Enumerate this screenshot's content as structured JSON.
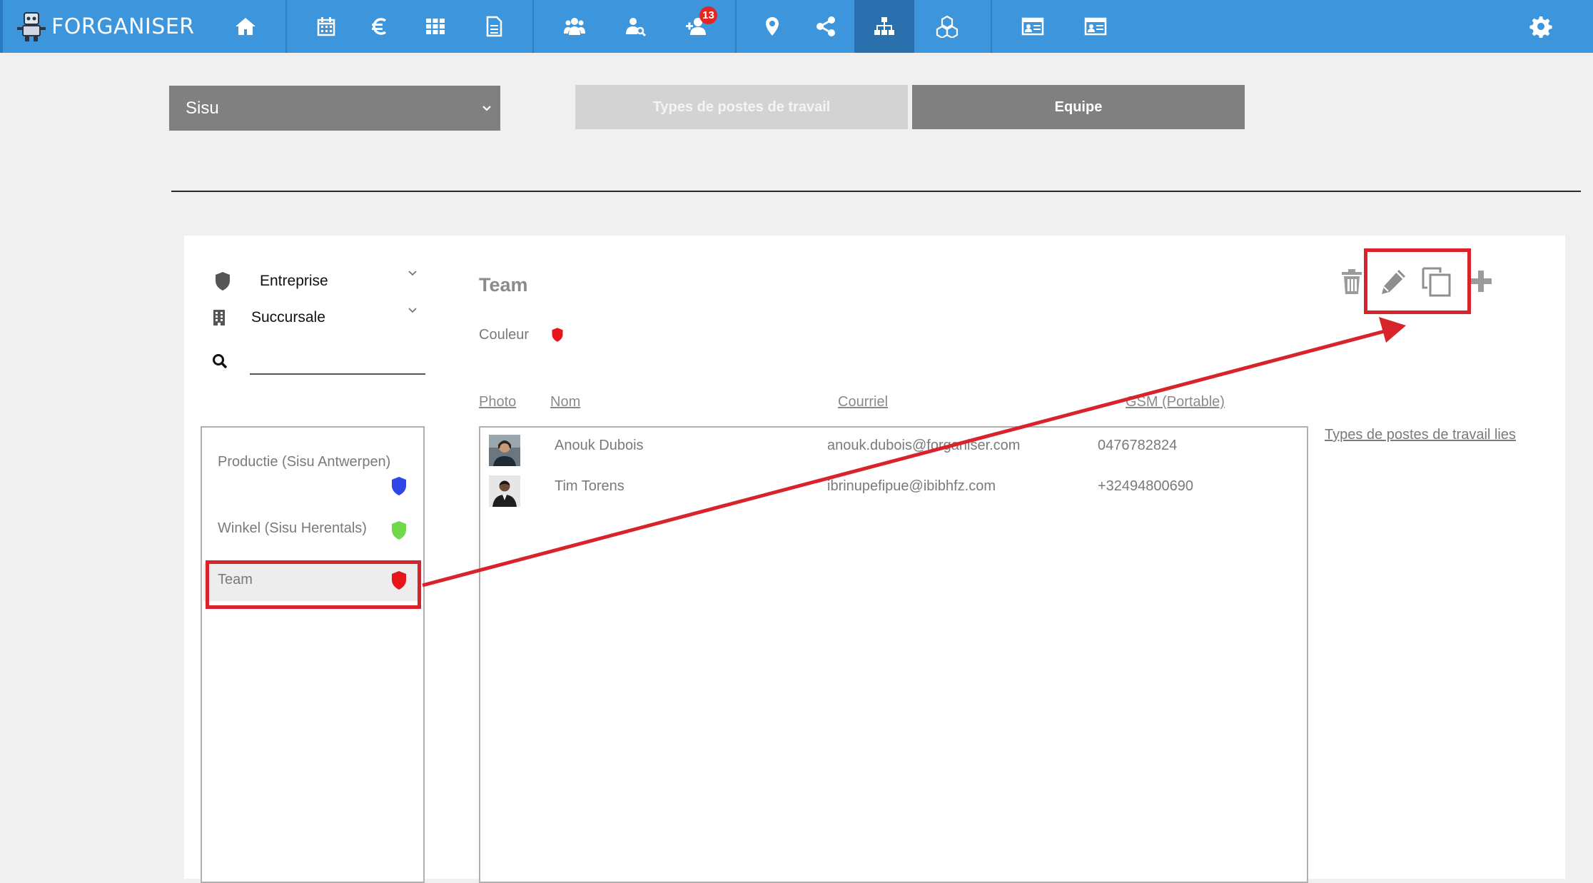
{
  "app": {
    "name": "FORGANISER"
  },
  "nav": {
    "notification_count": "13",
    "icons": [
      "home-icon",
      "calendar-icon",
      "euro-icon",
      "grid-icon",
      "document-icon",
      "team-icon",
      "user-search-icon",
      "add-user-icon",
      "map-pin-icon",
      "share-icon",
      "org-chart-icon",
      "cubes-icon",
      "id-card-icon",
      "id-card-icon",
      "gear-icon"
    ]
  },
  "filters": {
    "company_select": "Sisu",
    "tab_types": "Types de postes de travail",
    "tab_team": "Equipe"
  },
  "sidebar": {
    "company_label": "Entreprise",
    "branch_label": "Succursale",
    "search_placeholder": "",
    "groups": [
      {
        "label": "Productie (Sisu Antwerpen)",
        "color": "#2f45e6"
      },
      {
        "label": "Winkel (Sisu Herentals)",
        "color": "#6fd94a"
      },
      {
        "label": "Team",
        "color": "#e8141b"
      }
    ]
  },
  "detail": {
    "title": "Team",
    "color_label": "Couleur",
    "color": "#e8141b",
    "columns": {
      "photo": "Photo",
      "name": "Nom",
      "email": "Courriel",
      "phone": "GSM (Portable)"
    },
    "members": [
      {
        "name": "Anouk Dubois",
        "email": "anouk.dubois@forganiser.com",
        "phone": "0476782824"
      },
      {
        "name": "Tim Torens",
        "email": "ibrinupefipue@ibibhfz.com",
        "phone": "+32494800690"
      }
    ],
    "linked_types_link": "Types de postes de travail lies"
  },
  "annotation_color": "#d9232a"
}
